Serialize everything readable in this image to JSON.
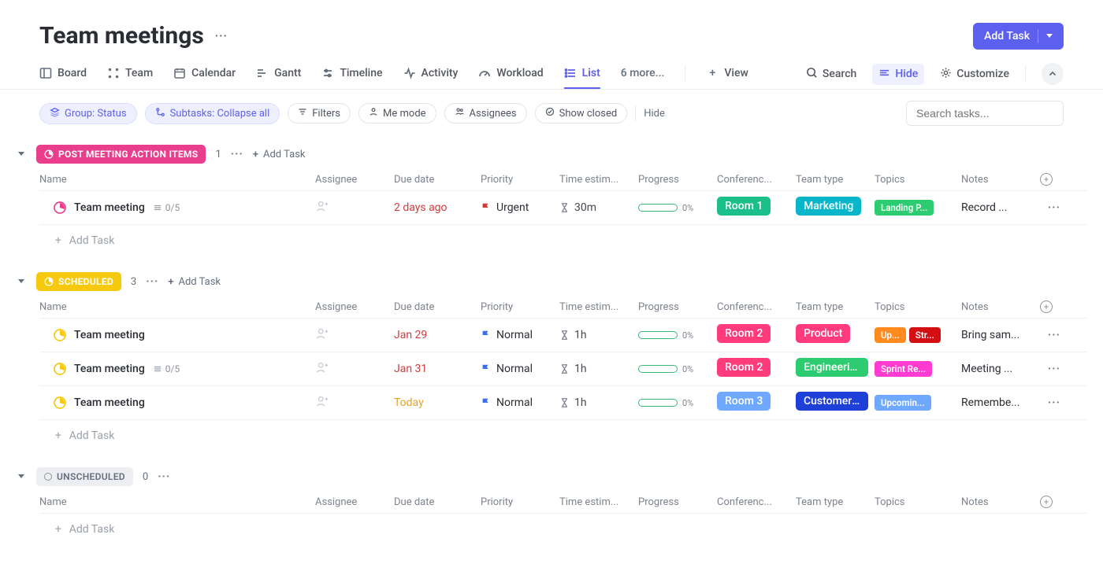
{
  "title": "Team meetings",
  "add_task": "Add Task",
  "tabs": {
    "board": "Board",
    "team": "Team",
    "calendar": "Calendar",
    "gantt": "Gantt",
    "timeline": "Timeline",
    "activity": "Activity",
    "workload": "Workload",
    "list": "List",
    "more": "6 more...",
    "view": "View"
  },
  "right_actions": {
    "search": "Search",
    "hide": "Hide",
    "customize": "Customize"
  },
  "filters": {
    "group": "Group: Status",
    "subtasks": "Subtasks: Collapse all",
    "filters": "Filters",
    "me": "Me mode",
    "assignees": "Assignees",
    "closed": "Show closed",
    "hide": "Hide",
    "search_placeholder": "Search tasks..."
  },
  "columns": {
    "name": "Name",
    "assignee": "Assignee",
    "due": "Due date",
    "priority": "Priority",
    "time": "Time estim...",
    "progress": "Progress",
    "conf": "Conferenc...",
    "teamtype": "Team type",
    "topics": "Topics",
    "notes": "Notes"
  },
  "groups": [
    {
      "id": "post",
      "label": "POST MEETING ACTION ITEMS",
      "color": "#e83e8c",
      "count": "1",
      "rows": [
        {
          "name": "Team meeting",
          "subtasks": "0/5",
          "due": "2 days ago",
          "due_kind": "overdue",
          "priority": "Urgent",
          "flag_color": "#d33a3a",
          "time": "30m",
          "progress": "0%",
          "conf": "Room 1",
          "conf_color": "#1bbf8a",
          "team": "Marketing",
          "team_color": "#08b6c9",
          "topics": [
            {
              "t": "Landing P...",
              "c": "#2ecc71"
            }
          ],
          "notes": "Record ..."
        }
      ]
    },
    {
      "id": "scheduled",
      "label": "SCHEDULED",
      "color": "#f6c90e",
      "count": "3",
      "rows": [
        {
          "name": "Team meeting",
          "due": "Jan 29",
          "due_kind": "overdue",
          "priority": "Normal",
          "flag_color": "#3a6ff0",
          "time": "1h",
          "progress": "0%",
          "conf": "Room 2",
          "conf_color": "#ff3b7b",
          "team": "Product",
          "team_color": "#ff3b7b",
          "topics": [
            {
              "t": "Up...",
              "c": "#ff8a1e"
            },
            {
              "t": "Str...",
              "c": "#d40f13"
            }
          ],
          "notes": "Bring sam..."
        },
        {
          "name": "Team meeting",
          "subtasks": "0/5",
          "due": "Jan 31",
          "due_kind": "overdue",
          "priority": "Normal",
          "flag_color": "#3a6ff0",
          "time": "1h",
          "progress": "0%",
          "conf": "Room 2",
          "conf_color": "#ff3b7b",
          "team": "Engineering",
          "team_color": "#2ecc71",
          "topics": [
            {
              "t": "Sprint Re...",
              "c": "#ff3bd2"
            }
          ],
          "notes": "Meeting ..."
        },
        {
          "name": "Team meeting",
          "due": "Today",
          "due_kind": "today",
          "priority": "Normal",
          "flag_color": "#3a6ff0",
          "time": "1h",
          "progress": "0%",
          "conf": "Room 3",
          "conf_color": "#6fa8ff",
          "team": "Customer ...",
          "team_color": "#1e3fd8",
          "topics": [
            {
              "t": "Upcomin...",
              "c": "#6fa8ff"
            }
          ],
          "notes": "Remembe..."
        }
      ]
    },
    {
      "id": "unscheduled",
      "label": "UNSCHEDULED",
      "color": "gray",
      "count": "0",
      "rows": []
    }
  ],
  "row_add": "Add Task"
}
